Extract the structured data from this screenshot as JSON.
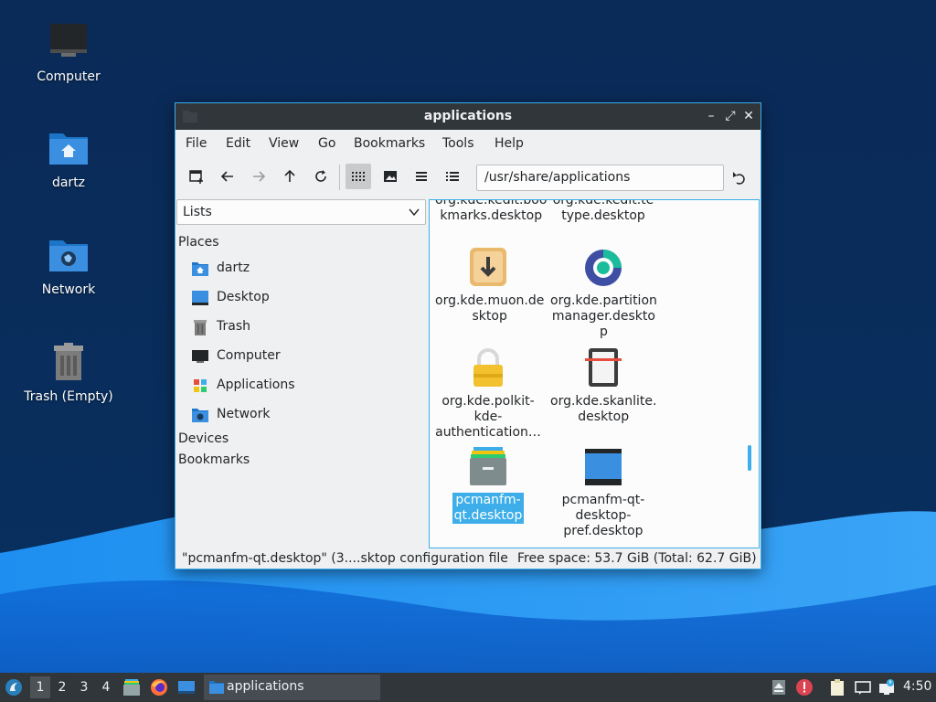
{
  "desktop": {
    "icons": [
      {
        "label": "Computer",
        "icon": "computer-icon"
      },
      {
        "label": "dartz",
        "icon": "home-folder-icon"
      },
      {
        "label": "Network",
        "icon": "network-folder-icon"
      },
      {
        "label": "Trash (Empty)",
        "icon": "trash-icon"
      }
    ]
  },
  "window": {
    "title": "applications",
    "controls": {
      "minimize": "–",
      "maximize": "⤢",
      "close": "✕"
    },
    "menu": [
      "File",
      "Edit",
      "View",
      "Go",
      "Bookmarks",
      "Tools",
      "Help"
    ],
    "path": "/usr/share/applications",
    "sidepane": {
      "mode": "Lists",
      "places_header": "Places",
      "places": [
        {
          "label": "dartz",
          "icon": "home-folder-icon"
        },
        {
          "label": "Desktop",
          "icon": "desktop-icon"
        },
        {
          "label": "Trash",
          "icon": "trash-icon"
        },
        {
          "label": "Computer",
          "icon": "computer-icon"
        },
        {
          "label": "Applications",
          "icon": "applications-icon"
        },
        {
          "label": "Network",
          "icon": "network-folder-icon"
        }
      ],
      "devices_header": "Devices",
      "bookmarks_header": "Bookmarks"
    },
    "files": [
      {
        "name": "org.kde.kedit.boo\nkmarks.desktop",
        "partial_top": true
      },
      {
        "name": "org.kde.kedit.te\ntype.desktop",
        "partial_top": true
      },
      {
        "name": "org.kde.muon.de\nsktop",
        "icon": "muon-icon"
      },
      {
        "name": "org.kde.partition\nmanager.deskto\np",
        "icon": "partition-manager-icon"
      },
      {
        "name": "org.kde.polkit-\nkde-\nauthentication…",
        "icon": "lock-icon"
      },
      {
        "name": "org.kde.skanlite.\ndesktop",
        "icon": "scanner-icon"
      },
      {
        "name": "pcmanfm-\nqt.desktop",
        "icon": "file-manager-icon",
        "selected": true
      },
      {
        "name": "pcmanfm-qt-\ndesktop-\npref.desktop",
        "icon": "desktop-pref-icon"
      }
    ],
    "status_left": "\"pcmanfm-qt.desktop\" (3....sktop configuration file",
    "status_right": "Free space: 53.7 GiB (Total: 62.7 GiB)"
  },
  "taskbar": {
    "workspaces": [
      "1",
      "2",
      "3",
      "4"
    ],
    "active_workspace": "1",
    "task_label": "applications",
    "clock": "4:50"
  },
  "colors": {
    "accent": "#3daee9",
    "titlebar": "#31363b",
    "window_bg": "#eff0f1"
  }
}
